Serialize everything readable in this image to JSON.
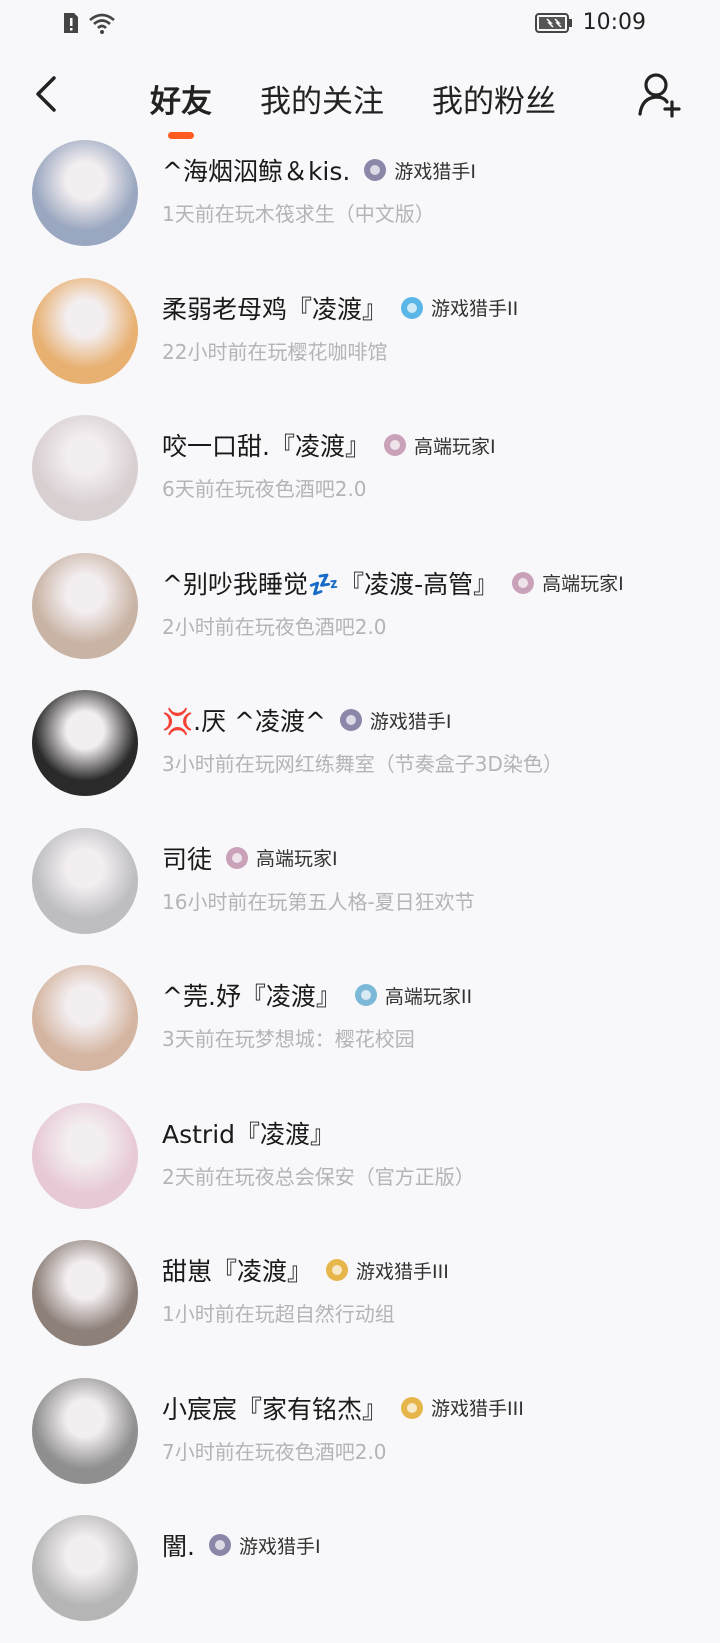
{
  "status_bar": {
    "time": "10:09"
  },
  "nav": {
    "tabs": [
      {
        "label": "好友",
        "active": true
      },
      {
        "label": "我的关注",
        "active": false
      },
      {
        "label": "我的粉丝",
        "active": false
      }
    ],
    "accent_color": "#ff5a1f"
  },
  "friends": [
    {
      "name": "^海烟泅鲸＆kis.",
      "badge": "游戏猎手I",
      "badge_color": "#8a87a8",
      "status": "1天前在玩木筏求生（中文版）",
      "avatar_color": "#9aa7c0"
    },
    {
      "name": "柔弱老母鸡『凌渡』",
      "badge": "游戏猎手II",
      "badge_color": "#5ab6e6",
      "status": "22小时前在玩樱花咖啡馆",
      "avatar_color": "#e8b071"
    },
    {
      "name": "咬一口甜.『凌渡』",
      "badge": "高端玩家I",
      "badge_color": "#c9a2b9",
      "status": "6天前在玩夜色酒吧2.0",
      "avatar_color": "#d8cfd1"
    },
    {
      "name": "^别吵我睡觉💤『凌渡-高管』",
      "badge": "高端玩家I",
      "badge_color": "#c9a2b9",
      "status": "2小时前在玩夜色酒吧2.0",
      "avatar_color": "#c9b3a4"
    },
    {
      "name": "💢.厌 ^凌渡^",
      "badge": "游戏猎手I",
      "badge_color": "#8a87a8",
      "status": "3小时前在玩网红练舞室（节奏盒子3D染色）",
      "avatar_color": "#2a2a2a"
    },
    {
      "name": "司徒",
      "badge": "高端玩家I",
      "badge_color": "#c9a2b9",
      "status": "16小时前在玩第五人格-夏日狂欢节",
      "avatar_color": "#bdbdc2"
    },
    {
      "name": "^莞.妤『凌渡』",
      "badge": "高端玩家II",
      "badge_color": "#7cb8d8",
      "status": "3天前在玩梦想城：樱花校园",
      "avatar_color": "#d4b5a1"
    },
    {
      "name": "Astrid『凌渡』",
      "badge": "",
      "badge_color": "",
      "status": "2天前在玩夜总会保安（官方正版）",
      "avatar_color": "#e7c9d6"
    },
    {
      "name": "甜崽『凌渡』",
      "badge": "游戏猎手III",
      "badge_color": "#e6b64a",
      "status": "1小时前在玩超自然行动组",
      "avatar_color": "#8d8079"
    },
    {
      "name": "小宸宸『家有铭杰』",
      "badge": "游戏猎手III",
      "badge_color": "#e6b64a",
      "status": "7小时前在玩夜色酒吧2.0",
      "avatar_color": "#8f8f8f"
    },
    {
      "name": "闇.",
      "badge": "游戏猎手I",
      "badge_color": "#8a87a8",
      "status": "",
      "avatar_color": "#b5b5b5"
    }
  ]
}
